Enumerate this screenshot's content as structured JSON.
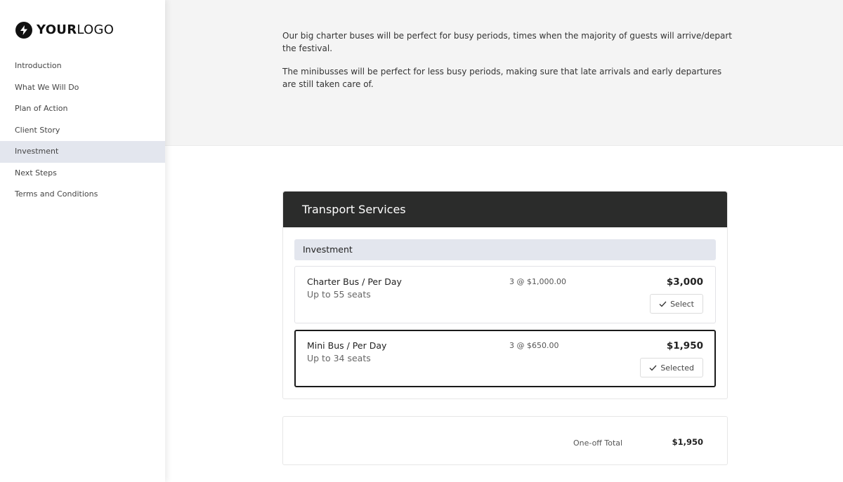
{
  "logo": {
    "bold": "YOUR",
    "light": "LOGO",
    "icon": "lightning-bolt-icon"
  },
  "sidebar": {
    "items": [
      {
        "label": "Introduction",
        "active": false
      },
      {
        "label": "What We Will Do",
        "active": false
      },
      {
        "label": "Plan of Action",
        "active": false
      },
      {
        "label": "Client Story",
        "active": false
      },
      {
        "label": "Investment",
        "active": true
      },
      {
        "label": "Next Steps",
        "active": false
      },
      {
        "label": "Terms and Conditions",
        "active": false
      }
    ]
  },
  "intro": {
    "paragraphs": [
      "Our big charter buses will be perfect for busy periods, times when the majority of guests will arrive/depart the festival.",
      "The minibusses will be perfect for less busy periods, making sure that late arrivals and early departures are still taken care of."
    ]
  },
  "pricing": {
    "title": "Transport Services",
    "section": "Investment",
    "items": [
      {
        "name": "Charter Bus / Per Day",
        "description": "Up to 55 seats",
        "quantity": "3 @ $1,000.00",
        "price": "$3,000",
        "button": "Select",
        "selected": false
      },
      {
        "name": "Mini Bus / Per Day",
        "description": "Up to 34 seats",
        "quantity": "3 @ $650.00",
        "price": "$1,950",
        "button": "Selected",
        "selected": true
      }
    ]
  },
  "total": {
    "label": "One-off Total",
    "value": "$1,950"
  },
  "colors": {
    "header_bg": "#2b2c2b",
    "active_nav_bg": "#e3e6ee",
    "section_bg": "#e3e6ee",
    "intro_bg": "#f4f4f4",
    "selected_border": "#1a1a1a"
  }
}
